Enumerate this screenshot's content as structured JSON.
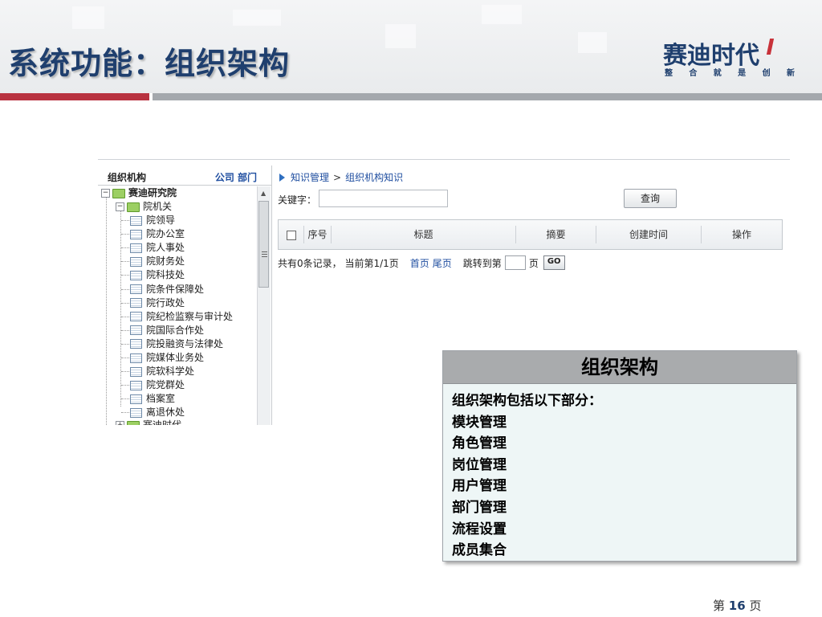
{
  "slide": {
    "title": "系统功能：组织架构",
    "logo_name": "赛迪时代",
    "logo_tagline": [
      "整",
      "合",
      "就",
      "是",
      "创",
      "新"
    ],
    "page_prefix": "第",
    "page_number": "16",
    "page_suffix": "页",
    "colors": {
      "title": "#1f3f6e",
      "accent_red": "#b83240",
      "rule_grey": "#a4a8ad"
    }
  },
  "tree": {
    "title": "组织机构",
    "links": "公司 部门",
    "root": {
      "label": "赛迪研究院",
      "expander": "−"
    },
    "group": {
      "label": "院机关",
      "expander": "−"
    },
    "children": [
      "院领导",
      "院办公室",
      "院人事处",
      "院财务处",
      "院科技处",
      "院条件保障处",
      "院行政处",
      "院纪检监察与审计处",
      "院国际合作处",
      "院投融资与法律处",
      "院媒体业务处",
      "院软科学处",
      "院党群处",
      "档案室",
      "离退休处"
    ],
    "next_root": {
      "label": "赛迪时代",
      "expander": "+"
    }
  },
  "breadcrumb": {
    "section": "知识管理",
    "separator": ">",
    "page": "组织机构知识"
  },
  "search": {
    "label": "关键字：",
    "value": "",
    "button": "查询"
  },
  "grid": {
    "columns": [
      "序号",
      "标题",
      "摘要",
      "创建时间",
      "操作"
    ]
  },
  "pager": {
    "summary": "共有0条记录， 当前第1/1页",
    "first": "首页",
    "last": "尾页",
    "jump_label": "跳转到第",
    "page_value": "",
    "page_unit": "页",
    "go": "GO"
  },
  "callout": {
    "title": "组织架构",
    "lines": [
      "组织架构包括以下部分：",
      "模块管理",
      "角色管理",
      "岗位管理",
      "用户管理",
      "部门管理",
      "流程设置",
      "成员集合"
    ]
  }
}
